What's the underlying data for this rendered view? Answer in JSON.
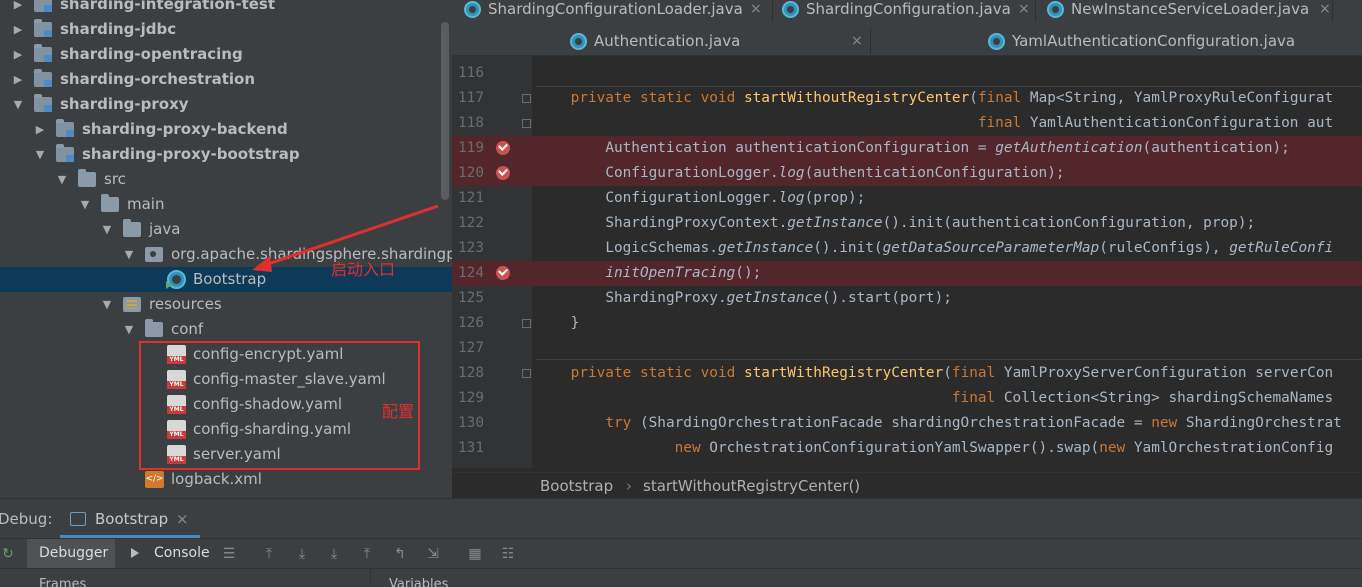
{
  "project_tree": {
    "items": [
      {
        "label": "sharding-integration-test",
        "arrow": "▶",
        "icon": "module-folder",
        "bold": true
      },
      {
        "label": "sharding-jdbc",
        "arrow": "▶",
        "icon": "module-folder",
        "bold": true
      },
      {
        "label": "sharding-opentracing",
        "arrow": "▶",
        "icon": "module-folder",
        "bold": true
      },
      {
        "label": "sharding-orchestration",
        "arrow": "▶",
        "icon": "module-folder",
        "bold": true
      },
      {
        "label": "sharding-proxy",
        "arrow": "▼",
        "icon": "module-folder",
        "bold": true
      },
      {
        "label": "sharding-proxy-backend",
        "arrow": "▶",
        "icon": "module-folder",
        "bold": true
      },
      {
        "label": "sharding-proxy-bootstrap",
        "arrow": "▼",
        "icon": "module-folder",
        "bold": true
      },
      {
        "label": "src",
        "arrow": "▼",
        "icon": "folder",
        "bold": false
      },
      {
        "label": "main",
        "arrow": "▼",
        "icon": "folder",
        "bold": false
      },
      {
        "label": "java",
        "arrow": "▼",
        "icon": "folder",
        "bold": false
      },
      {
        "label": "org.apache.shardingsphere.shardingpr",
        "arrow": "▼",
        "icon": "package",
        "bold": false
      },
      {
        "label": "Bootstrap",
        "arrow": "",
        "icon": "class",
        "bold": false,
        "selected": true
      },
      {
        "label": "resources",
        "arrow": "▼",
        "icon": "resources-folder",
        "bold": false
      },
      {
        "label": "conf",
        "arrow": "▼",
        "icon": "folder",
        "bold": false
      },
      {
        "label": "config-encrypt.yaml",
        "arrow": "",
        "icon": "yaml",
        "bold": false
      },
      {
        "label": "config-master_slave.yaml",
        "arrow": "",
        "icon": "yaml",
        "bold": false
      },
      {
        "label": "config-shadow.yaml",
        "arrow": "",
        "icon": "yaml",
        "bold": false
      },
      {
        "label": "config-sharding.yaml",
        "arrow": "",
        "icon": "yaml",
        "bold": false
      },
      {
        "label": "server.yaml",
        "arrow": "",
        "icon": "yaml",
        "bold": false
      },
      {
        "label": "logback.xml",
        "arrow": "",
        "icon": "xml",
        "bold": false
      }
    ],
    "yaml_badge": "YML",
    "xml_badge": "</>"
  },
  "annotations": {
    "entry_label": "启动入口",
    "config_label": "配置",
    "color": "#e0302e"
  },
  "editor_tabs": {
    "row1": [
      {
        "label": "ShardingConfigurationLoader.java"
      },
      {
        "label": "ShardingConfiguration.java"
      },
      {
        "label": "NewInstanceServiceLoader.java"
      }
    ],
    "row2": [
      {
        "label": "Authentication.java"
      },
      {
        "label": "YamlAuthenticationConfiguration.java"
      }
    ],
    "close_glyph": "×"
  },
  "code_lines": [
    {
      "num": "116",
      "text": ""
    },
    {
      "num": "117",
      "text": "    private static void startWithoutRegistryCenter(final Map<String, YamlProxyRuleConfigurat"
    },
    {
      "num": "118",
      "text": "                                                   final YamlAuthenticationConfiguration aut"
    },
    {
      "num": "119",
      "text": "        Authentication authenticationConfiguration = getAuthentication(authentication);",
      "breakpoint": true
    },
    {
      "num": "120",
      "text": "        ConfigurationLogger.log(authenticationConfiguration);",
      "breakpoint": true
    },
    {
      "num": "121",
      "text": "        ConfigurationLogger.log(prop);"
    },
    {
      "num": "122",
      "text": "        ShardingProxyContext.getInstance().init(authenticationConfiguration, prop);"
    },
    {
      "num": "123",
      "text": "        LogicSchemas.getInstance().init(getDataSourceParameterMap(ruleConfigs), getRuleConfi"
    },
    {
      "num": "124",
      "text": "        initOpenTracing();",
      "breakpoint": true
    },
    {
      "num": "125",
      "text": "        ShardingProxy.getInstance().start(port);"
    },
    {
      "num": "126",
      "text": "    }"
    },
    {
      "num": "127",
      "text": ""
    },
    {
      "num": "128",
      "text": "    private static void startWithRegistryCenter(final YamlProxyServerConfiguration serverCon"
    },
    {
      "num": "129",
      "text": "                                                final Collection<String> shardingSchemaNames"
    },
    {
      "num": "130",
      "text": "        try (ShardingOrchestrationFacade shardingOrchestrationFacade = new ShardingOrchestrat"
    },
    {
      "num": "131",
      "text": "                new OrchestrationConfigurationYamlSwapper().swap(new YamlOrchestrationConfig"
    }
  ],
  "breadcrumb": {
    "items": [
      "Bootstrap",
      "startWithoutRegistryCenter()"
    ],
    "separator": "›"
  },
  "debug": {
    "title": "Debug:",
    "tab_label": "Bootstrap",
    "tab_close": "×",
    "debugger_label": "Debugger",
    "console_label": "Console",
    "frames_label": "Frames",
    "variables_label": "Variables"
  }
}
